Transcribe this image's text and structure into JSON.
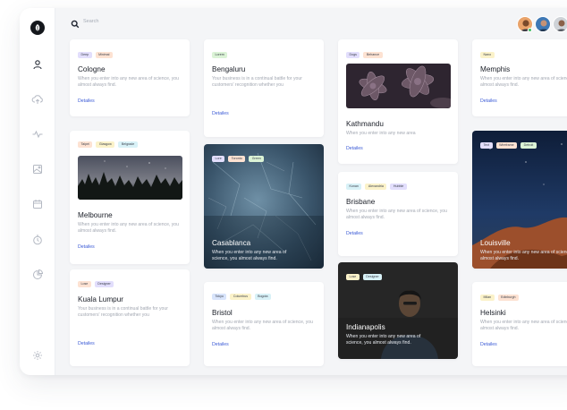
{
  "search": {
    "placeholder": "Search",
    "value": ""
  },
  "avatars": [
    {
      "name": "user-avatar-1",
      "online": true
    },
    {
      "name": "user-avatar-2",
      "online": false
    },
    {
      "name": "user-avatar-3",
      "online": false
    }
  ],
  "sidebar": {
    "logo_icon": "leaf-icon",
    "items": [
      {
        "icon": "user-icon",
        "active": true
      },
      {
        "icon": "cloud-upload-icon"
      },
      {
        "icon": "activity-icon"
      },
      {
        "icon": "image-icon"
      },
      {
        "icon": "calendar-icon"
      },
      {
        "icon": "clock-icon"
      },
      {
        "icon": "pie-chart-icon"
      }
    ],
    "footer_icon": "settings-icon"
  },
  "colors": {
    "link": "#3b5bd6",
    "tag_green": "#dbf3d6",
    "tag_purple": "#e2defc",
    "tag_orange": "#fde2d2",
    "tag_yellow": "#fbf2c9",
    "tag_cyan": "#d8f1f7",
    "tag_blue": "#d8e4fb"
  },
  "cards": {
    "cologne": {
      "tags": [
        "Deep",
        "Minimal"
      ],
      "title": "Cologne",
      "desc": "When you enter into any new area of science, you almost always find.",
      "link": "Detailes"
    },
    "bengaluru": {
      "tags": [
        "Lorem"
      ],
      "title": "Bengaluru",
      "desc": "Your business is in a continual battle for your customers' recognition whether you",
      "link": "Detailes"
    },
    "kathmandu": {
      "tags": [
        "Dogs",
        "Behance"
      ],
      "title": "Kathmandu",
      "desc": "When you enter into any new area",
      "link": "Detailes"
    },
    "memphis": {
      "tags": [
        "Nano"
      ],
      "title": "Memphis",
      "desc": "When you enter into any new area of science, you almost always find.",
      "link": "Detailes"
    },
    "melbourne": {
      "tags": [
        "Taipei",
        "Glasgow",
        "Belgrade"
      ],
      "title": "Melbourne",
      "desc": "When you enter into any new area of science, you almost always find.",
      "link": "Detailes"
    },
    "casablanca": {
      "tags": [
        "Lore",
        "Toronto",
        "Green"
      ],
      "title": "Casablanca",
      "desc": "When you enter into any new area of science, you almost always find."
    },
    "brisbane": {
      "tags": [
        "Konan",
        "Alexandria",
        "Hubble"
      ],
      "title": "Brisbane",
      "desc": "When you enter into any new area of science, you almost always find.",
      "link": "Detailes"
    },
    "louisville": {
      "tags": [
        "Text",
        "Wireframe",
        "Detroit"
      ],
      "title": "Louisville",
      "desc": "When you enter into any new area of science, you almost always find."
    },
    "kuala": {
      "tags": [
        "Lose",
        "Designer"
      ],
      "title": "Kuala Lumpur",
      "desc": "Your business is in a continual battle for your customers' recognition whether you",
      "link": "Detailes"
    },
    "bristol": {
      "tags": [
        "Tokyo",
        "Columbus",
        "Bogota"
      ],
      "title": "Bristol",
      "desc": "When you enter into any new area of science, you almost always find.",
      "link": "Detailes"
    },
    "indianapolis": {
      "tags": [
        "Lose",
        "Designer"
      ],
      "title": "Indianapolis",
      "desc": "When you enter into any new area of science, you almost always find."
    },
    "helsinki": {
      "tags": [
        "Milan",
        "Edinburgh"
      ],
      "title": "Helsinki",
      "desc": "When you enter into any new area of science, you almost always find.",
      "link": "Detailes"
    }
  }
}
